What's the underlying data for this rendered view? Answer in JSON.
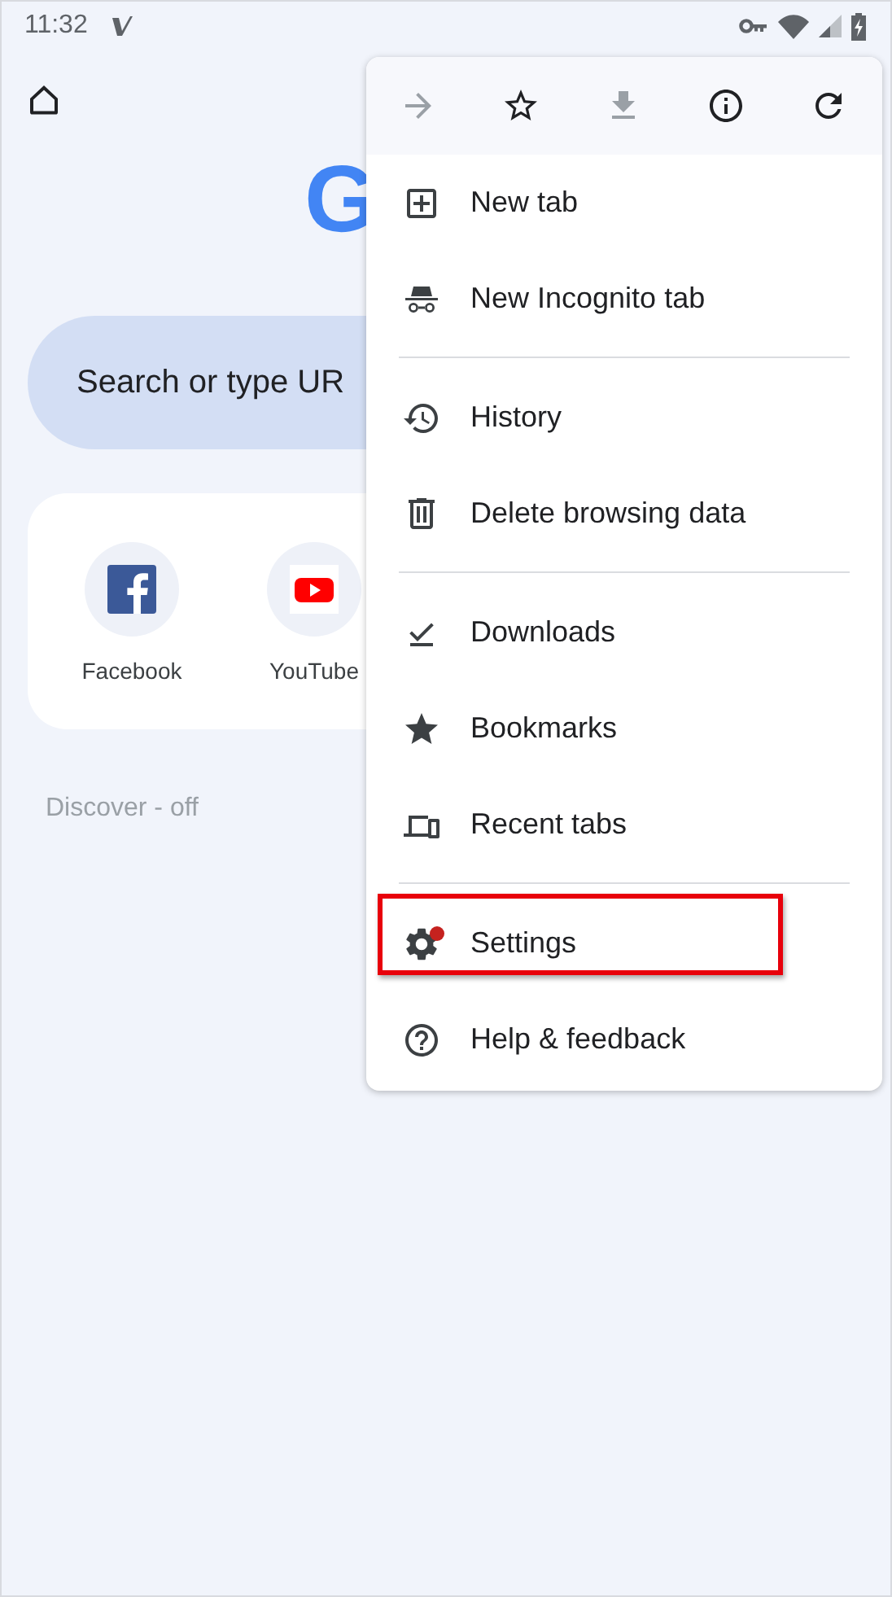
{
  "status_bar": {
    "time": "11:32"
  },
  "logo": "G",
  "search": {
    "placeholder": "Search or type UR"
  },
  "shortcuts": [
    {
      "label": "Facebook",
      "kind": "facebook"
    },
    {
      "label": "YouTube",
      "kind": "youtube"
    }
  ],
  "discover": "Discover - off",
  "menu": {
    "actions": [
      {
        "kind": "forward",
        "disabled": true
      },
      {
        "kind": "bookmark",
        "disabled": false
      },
      {
        "kind": "download",
        "disabled": true
      },
      {
        "kind": "info",
        "disabled": false
      },
      {
        "kind": "refresh",
        "disabled": false
      }
    ],
    "groups": [
      [
        {
          "label": "New tab",
          "kind": "new-tab",
          "badge": false,
          "highlighted": false
        },
        {
          "label": "New Incognito tab",
          "kind": "incognito",
          "badge": false,
          "highlighted": false
        }
      ],
      [
        {
          "label": "History",
          "kind": "history",
          "badge": false,
          "highlighted": false
        },
        {
          "label": "Delete browsing data",
          "kind": "delete",
          "badge": false,
          "highlighted": false
        }
      ],
      [
        {
          "label": "Downloads",
          "kind": "downloads",
          "badge": false,
          "highlighted": false
        },
        {
          "label": "Bookmarks",
          "kind": "bookmarks",
          "badge": false,
          "highlighted": false
        },
        {
          "label": "Recent tabs",
          "kind": "recent-tabs",
          "badge": false,
          "highlighted": false
        }
      ],
      [
        {
          "label": "Settings",
          "kind": "settings",
          "badge": true,
          "highlighted": true
        },
        {
          "label": "Help & feedback",
          "kind": "help",
          "badge": false,
          "highlighted": false
        }
      ]
    ]
  }
}
